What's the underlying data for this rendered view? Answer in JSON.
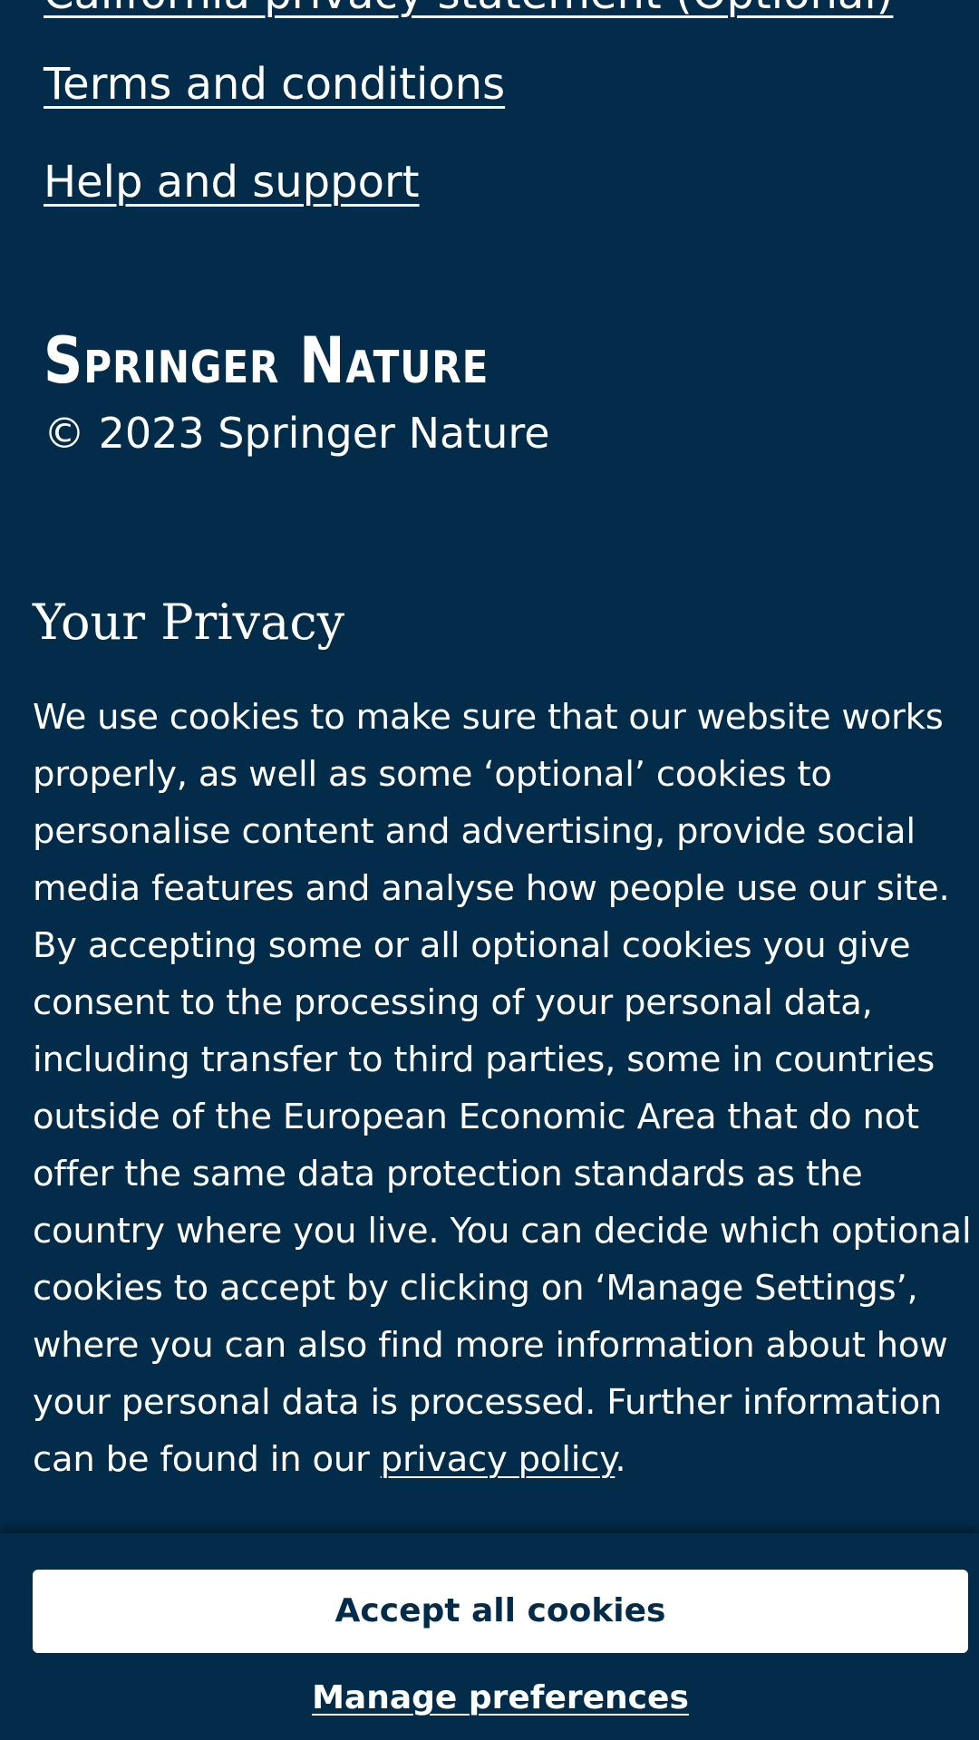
{
  "footer": {
    "links": [
      "California privacy statement (Optional)",
      "Terms and conditions",
      "Help and support"
    ],
    "brand": "Springer Nature",
    "copyright": "© 2023 Springer Nature"
  },
  "privacy": {
    "heading": "Your Privacy",
    "body_lines": [
      "We use cookies to make sure that our website works",
      "properly, as well as some ‘optional’ cookies to",
      "personalise content and advertising, provide social",
      "media features and analyse how people use our site.",
      "By accepting some or all optional cookies you give",
      "consent to the processing of your personal data,",
      "including transfer to third parties, some in countries",
      "outside of the European Economic Area that do not",
      "offer the same data protection standards as the",
      "country where you live. You can decide which optional",
      "cookies to accept by clicking on ‘Manage Settings’,",
      "where you can also find more information about how",
      "your personal data is processed. Further information"
    ],
    "last_line_prefix": "can be found in our ",
    "policy_link": "privacy policy",
    "last_line_suffix": "."
  },
  "consent": {
    "accept_label": "Accept all cookies",
    "manage_label": "Manage preferences"
  },
  "colors": {
    "background": "#022c4a",
    "text": "#ffffff",
    "button_background": "#ffffff",
    "button_text": "#022c4a"
  }
}
